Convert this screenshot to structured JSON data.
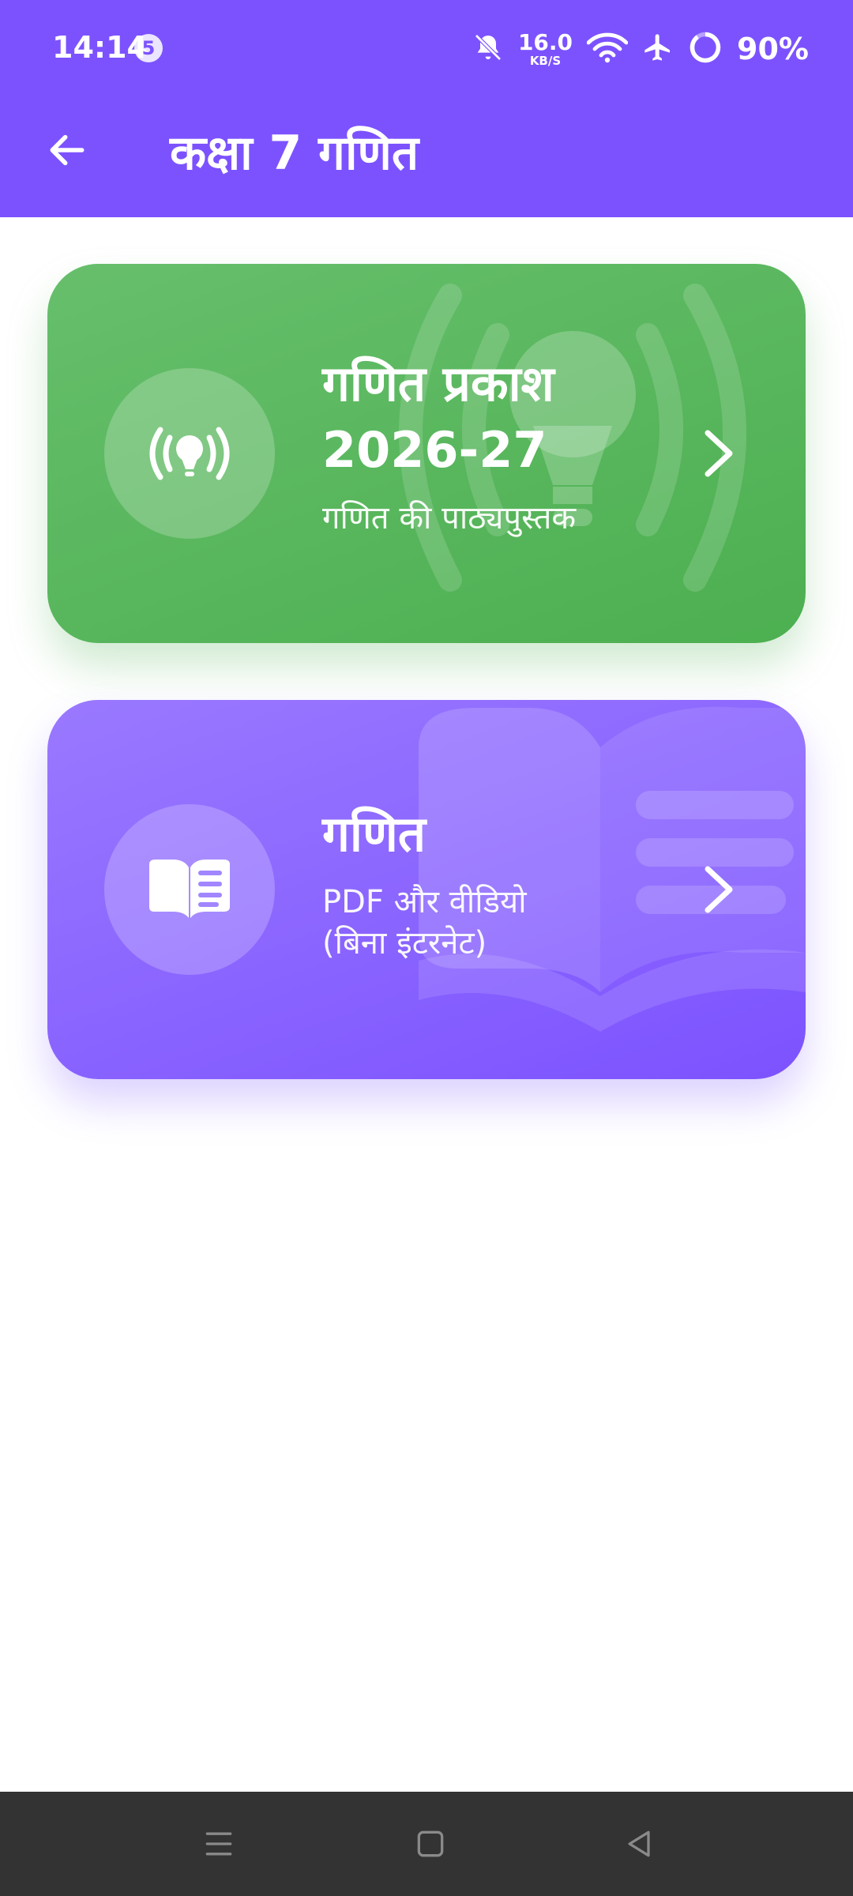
{
  "status_bar": {
    "time": "14:14",
    "notification_count": "5",
    "net_speed_value": "16.0",
    "net_speed_unit": "KB/S",
    "battery": "90%",
    "icons": [
      "bell-off-icon",
      "wifi-icon",
      "airplane-icon",
      "battery-ring-icon"
    ]
  },
  "app_bar": {
    "title": "कक्षा 7 गणित",
    "back_icon": "arrow-left-icon"
  },
  "cards": [
    {
      "title": "गणित प्रकाश\n2026-27",
      "subtitle": "गणित की पाठ्यपुस्तक",
      "icon": "broadcast-bulb-icon",
      "color": "#4caf50"
    },
    {
      "title": "गणित",
      "subtitle": "PDF और वीडियो\n(बिना इंटरनेट)",
      "icon": "open-book-icon",
      "color": "#7c52ff"
    }
  ],
  "nav_bar": {
    "buttons": [
      "menu-icon",
      "home-icon",
      "back-triangle-icon"
    ]
  },
  "colors": {
    "accent": "#7c52ff",
    "green": "#4caf50",
    "nav": "#333333"
  }
}
